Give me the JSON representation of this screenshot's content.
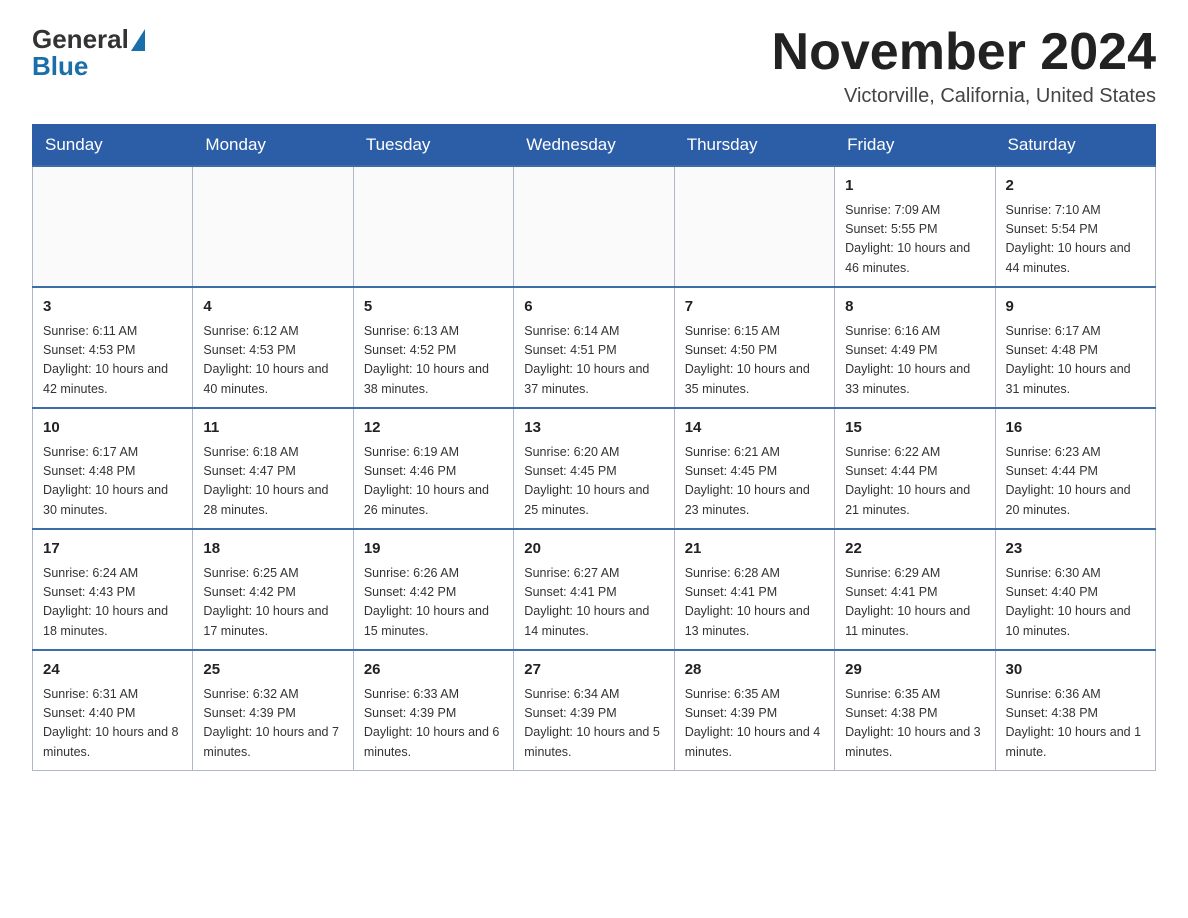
{
  "header": {
    "logo_general": "General",
    "logo_blue": "Blue",
    "month_year": "November 2024",
    "location": "Victorville, California, United States"
  },
  "days_of_week": [
    "Sunday",
    "Monday",
    "Tuesday",
    "Wednesday",
    "Thursday",
    "Friday",
    "Saturday"
  ],
  "weeks": [
    [
      {
        "day": "",
        "info": ""
      },
      {
        "day": "",
        "info": ""
      },
      {
        "day": "",
        "info": ""
      },
      {
        "day": "",
        "info": ""
      },
      {
        "day": "",
        "info": ""
      },
      {
        "day": "1",
        "info": "Sunrise: 7:09 AM\nSunset: 5:55 PM\nDaylight: 10 hours and 46 minutes."
      },
      {
        "day": "2",
        "info": "Sunrise: 7:10 AM\nSunset: 5:54 PM\nDaylight: 10 hours and 44 minutes."
      }
    ],
    [
      {
        "day": "3",
        "info": "Sunrise: 6:11 AM\nSunset: 4:53 PM\nDaylight: 10 hours and 42 minutes."
      },
      {
        "day": "4",
        "info": "Sunrise: 6:12 AM\nSunset: 4:53 PM\nDaylight: 10 hours and 40 minutes."
      },
      {
        "day": "5",
        "info": "Sunrise: 6:13 AM\nSunset: 4:52 PM\nDaylight: 10 hours and 38 minutes."
      },
      {
        "day": "6",
        "info": "Sunrise: 6:14 AM\nSunset: 4:51 PM\nDaylight: 10 hours and 37 minutes."
      },
      {
        "day": "7",
        "info": "Sunrise: 6:15 AM\nSunset: 4:50 PM\nDaylight: 10 hours and 35 minutes."
      },
      {
        "day": "8",
        "info": "Sunrise: 6:16 AM\nSunset: 4:49 PM\nDaylight: 10 hours and 33 minutes."
      },
      {
        "day": "9",
        "info": "Sunrise: 6:17 AM\nSunset: 4:48 PM\nDaylight: 10 hours and 31 minutes."
      }
    ],
    [
      {
        "day": "10",
        "info": "Sunrise: 6:17 AM\nSunset: 4:48 PM\nDaylight: 10 hours and 30 minutes."
      },
      {
        "day": "11",
        "info": "Sunrise: 6:18 AM\nSunset: 4:47 PM\nDaylight: 10 hours and 28 minutes."
      },
      {
        "day": "12",
        "info": "Sunrise: 6:19 AM\nSunset: 4:46 PM\nDaylight: 10 hours and 26 minutes."
      },
      {
        "day": "13",
        "info": "Sunrise: 6:20 AM\nSunset: 4:45 PM\nDaylight: 10 hours and 25 minutes."
      },
      {
        "day": "14",
        "info": "Sunrise: 6:21 AM\nSunset: 4:45 PM\nDaylight: 10 hours and 23 minutes."
      },
      {
        "day": "15",
        "info": "Sunrise: 6:22 AM\nSunset: 4:44 PM\nDaylight: 10 hours and 21 minutes."
      },
      {
        "day": "16",
        "info": "Sunrise: 6:23 AM\nSunset: 4:44 PM\nDaylight: 10 hours and 20 minutes."
      }
    ],
    [
      {
        "day": "17",
        "info": "Sunrise: 6:24 AM\nSunset: 4:43 PM\nDaylight: 10 hours and 18 minutes."
      },
      {
        "day": "18",
        "info": "Sunrise: 6:25 AM\nSunset: 4:42 PM\nDaylight: 10 hours and 17 minutes."
      },
      {
        "day": "19",
        "info": "Sunrise: 6:26 AM\nSunset: 4:42 PM\nDaylight: 10 hours and 15 minutes."
      },
      {
        "day": "20",
        "info": "Sunrise: 6:27 AM\nSunset: 4:41 PM\nDaylight: 10 hours and 14 minutes."
      },
      {
        "day": "21",
        "info": "Sunrise: 6:28 AM\nSunset: 4:41 PM\nDaylight: 10 hours and 13 minutes."
      },
      {
        "day": "22",
        "info": "Sunrise: 6:29 AM\nSunset: 4:41 PM\nDaylight: 10 hours and 11 minutes."
      },
      {
        "day": "23",
        "info": "Sunrise: 6:30 AM\nSunset: 4:40 PM\nDaylight: 10 hours and 10 minutes."
      }
    ],
    [
      {
        "day": "24",
        "info": "Sunrise: 6:31 AM\nSunset: 4:40 PM\nDaylight: 10 hours and 8 minutes."
      },
      {
        "day": "25",
        "info": "Sunrise: 6:32 AM\nSunset: 4:39 PM\nDaylight: 10 hours and 7 minutes."
      },
      {
        "day": "26",
        "info": "Sunrise: 6:33 AM\nSunset: 4:39 PM\nDaylight: 10 hours and 6 minutes."
      },
      {
        "day": "27",
        "info": "Sunrise: 6:34 AM\nSunset: 4:39 PM\nDaylight: 10 hours and 5 minutes."
      },
      {
        "day": "28",
        "info": "Sunrise: 6:35 AM\nSunset: 4:39 PM\nDaylight: 10 hours and 4 minutes."
      },
      {
        "day": "29",
        "info": "Sunrise: 6:35 AM\nSunset: 4:38 PM\nDaylight: 10 hours and 3 minutes."
      },
      {
        "day": "30",
        "info": "Sunrise: 6:36 AM\nSunset: 4:38 PM\nDaylight: 10 hours and 1 minute."
      }
    ]
  ]
}
